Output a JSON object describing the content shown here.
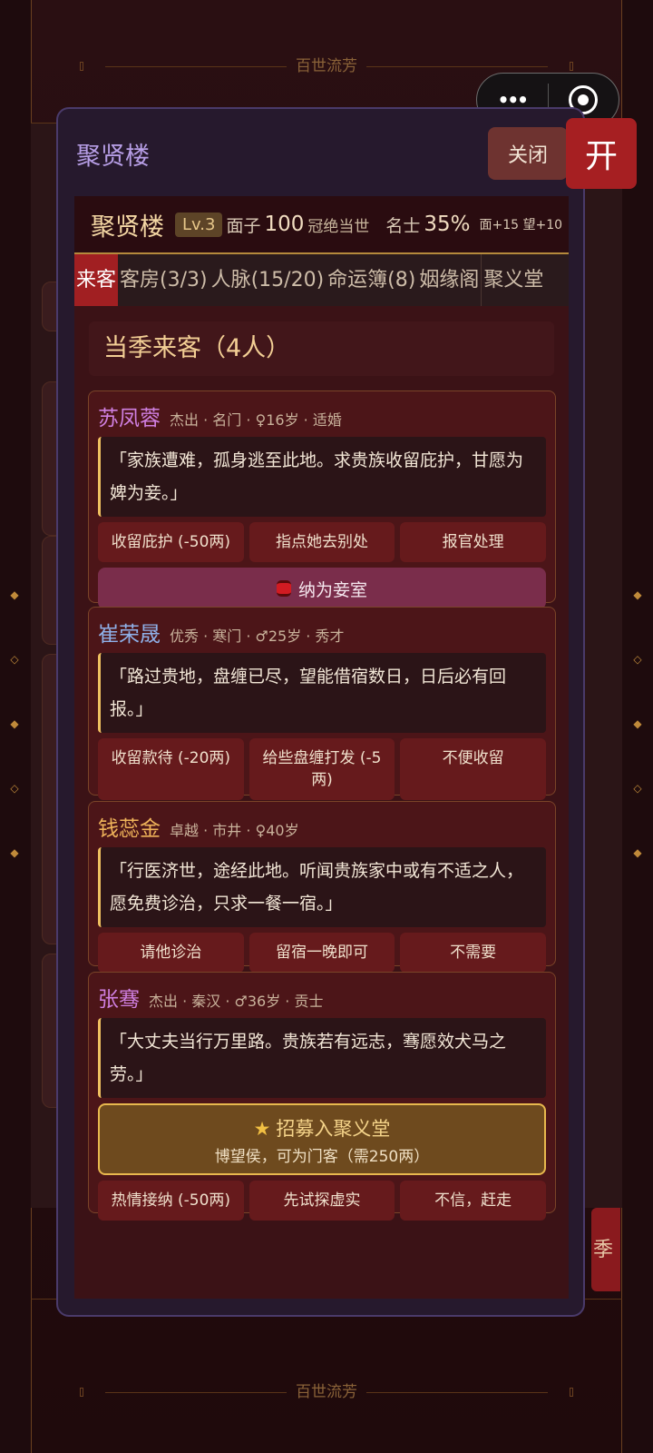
{
  "background": {
    "top_title": "百世流芳",
    "bottom_title": "百世流芳",
    "right_button_label": "季"
  },
  "capsule": {
    "more_icon": "more-dots-icon",
    "close_icon": "target-circle-icon"
  },
  "side_button": {
    "label": "开"
  },
  "modal": {
    "title": "聚贤楼",
    "close_label": "关闭",
    "header": {
      "name": "聚贤楼",
      "level": "Lv.3",
      "face_label": "面子",
      "face_value": "100",
      "face_rank": "冠绝当世",
      "scholar_label": "名士",
      "scholar_value": "35%",
      "bonus": "面+15 望+10"
    },
    "tabs": [
      {
        "label": "来客",
        "active": true
      },
      {
        "label": "客房(3/3)"
      },
      {
        "label": "人脉(15/20)"
      },
      {
        "label": "命运簿(8)"
      },
      {
        "label": "姻缘阁"
      },
      {
        "label": "聚义堂"
      }
    ],
    "section_title": "当季来客（4人）",
    "guests": [
      {
        "name": "苏凤蓉",
        "name_color": "#cf7fe0",
        "meta": "杰出 · 名门 · ♀16岁 · 适婚",
        "quote": "「家族遭难，孤身逃至此地。求贵族收留庇护，甘愿为婢为妾。」",
        "options": [
          "收留庇护 (-50两)",
          "指点她去别处",
          "报官处理"
        ],
        "extra": "纳为妾室"
      },
      {
        "name": "崔荣晟",
        "name_color": "#8fb0e8",
        "meta": "优秀 · 寒门 · ♂25岁 · 秀才",
        "quote": "「路过贵地，盘缠已尽，望能借宿数日，日后必有回报。」",
        "options": [
          "收留款待 (-20两)",
          "给些盘缠打发 (-5两)",
          "不便收留"
        ]
      },
      {
        "name": "钱蕊金",
        "name_color": "#efb35a",
        "meta": "卓越 · 市井 · ♀40岁",
        "quote": "「行医济世，途经此地。听闻贵族家中或有不适之人，愿免费诊治，只求一餐一宿。」",
        "options": [
          "请他诊治",
          "留宿一晚即可",
          "不需要"
        ]
      },
      {
        "name": "张骞",
        "name_color": "#cf7fe0",
        "meta": "杰出 · 秦汉 · ♂36岁 · 贡士",
        "quote": "「大丈夫当行万里路。贵族若有远志，骞愿效犬马之劳。」",
        "recruit_title": "招募入聚义堂",
        "recruit_sub": "博望侯，可为门客（需250两）",
        "options": [
          "热情接纳 (-50两)",
          "先试探虚实",
          "不信，赶走"
        ]
      }
    ]
  }
}
